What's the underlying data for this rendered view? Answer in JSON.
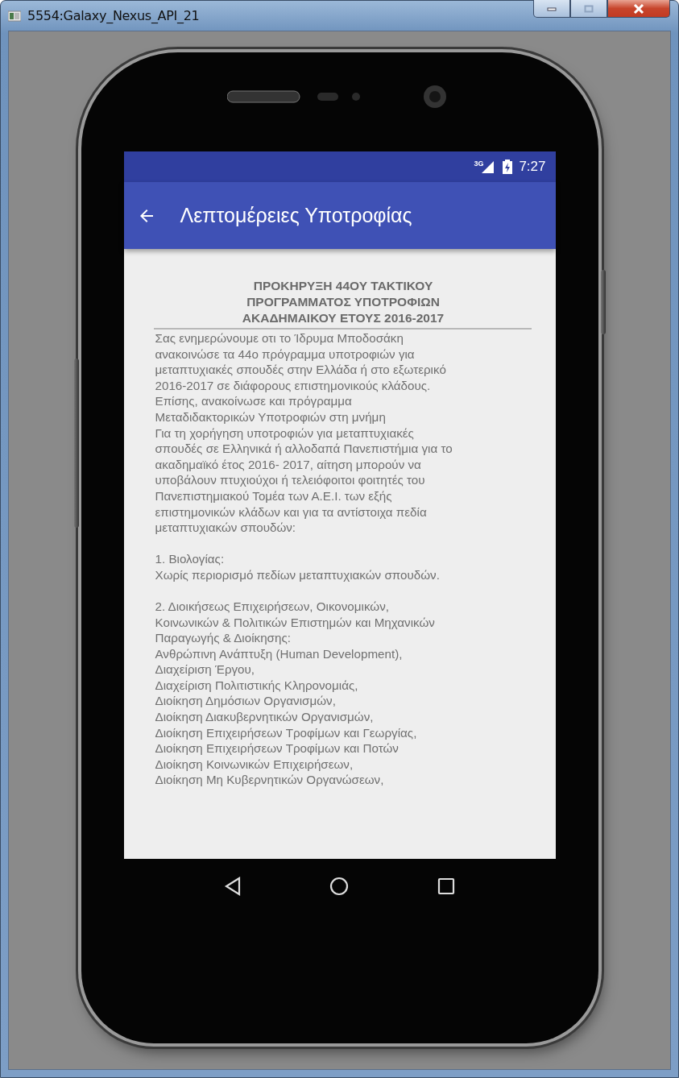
{
  "window": {
    "title": "5554:Galaxy_Nexus_API_21"
  },
  "status_bar": {
    "network": "3G",
    "time": "7:27"
  },
  "app_bar": {
    "title": "Λεπτομέρειες Υποτροφίας"
  },
  "heading": [
    "ΠΡΟΚΗΡΥΞΗ 44ΟΥ ΤΑΚΤΙΚΟΥ",
    "ΠΡΟΓΡΑΜΜΑΤΟΣ ΥΠΟΤΡΟΦΙΩΝ",
    "ΑΚΑΔΗΜΑΙΚΟΥ ΕΤΟΥΣ 2016-2017"
  ],
  "body": [
    {
      "lines": [
        "Σας ενημερώνουμε οτι το Ίδρυμα Μποδοσάκη",
        "ανακοινώσε τα 44ο πρόγραμμα υποτροφιών για",
        "μεταπτυχιακές σπουδές στην Ελλάδα ή στο εξωτερικό",
        "2016-2017 σε διάφορους επιστημονικούς κλάδους.",
        "Επίσης, ανακοίνωσε και πρόγραμμα",
        "Μεταδιδακτορικών Υποτροφιών στη μνήμη",
        "Για τη χορήγηση υποτροφιών για μεταπτυχιακές",
        "σπουδές σε Ελληνικά ή αλλοδαπά Πανεπιστήμια για το",
        "ακαδημαϊκό έτος 2016- 2017, αίτηση μπορούν να",
        "υποβάλουν πτυχιούχοι ή τελειόφοιτοι φοιτητές του",
        "Πανεπιστημιακού Τομέα των Α.Ε.Ι. των εξής",
        "επιστημονικών κλάδων και για τα αντίστοιχα πεδία",
        "μεταπτυχιακών σπουδών:"
      ]
    },
    {
      "lines": [
        "1. Βιολογίας:",
        "Χωρίς περιορισμό πεδίων μεταπτυχιακών σπουδών."
      ]
    },
    {
      "lines": [
        "2. Διοικήσεως Επιχειρήσεων, Οικονομικών,",
        "Κοινωνικών & Πολιτικών Επιστημών και Μηχανικών",
        "Παραγωγής & Διοίκησης:",
        "Ανθρώπινη Ανάπτυξη (Human Development),",
        "Διαχείριση Έργου,",
        "Διαχείριση Πολιτιστικής Κληρονομιάς,",
        "Διοίκηση Δημόσιων Οργανισμών,",
        "Διοίκηση Διακυβερνητικών Οργανισμών,",
        "Διοίκηση Επιχειρήσεων Τροφίμων και Γεωργίας,",
        "Διοίκηση Επιχειρήσεων Τροφίμων και Ποτών",
        "Διοίκηση Κοινωνικών Επιχειρήσεων,",
        "Διοίκηση Μη Κυβερνητικών Οργανώσεων,"
      ]
    }
  ]
}
